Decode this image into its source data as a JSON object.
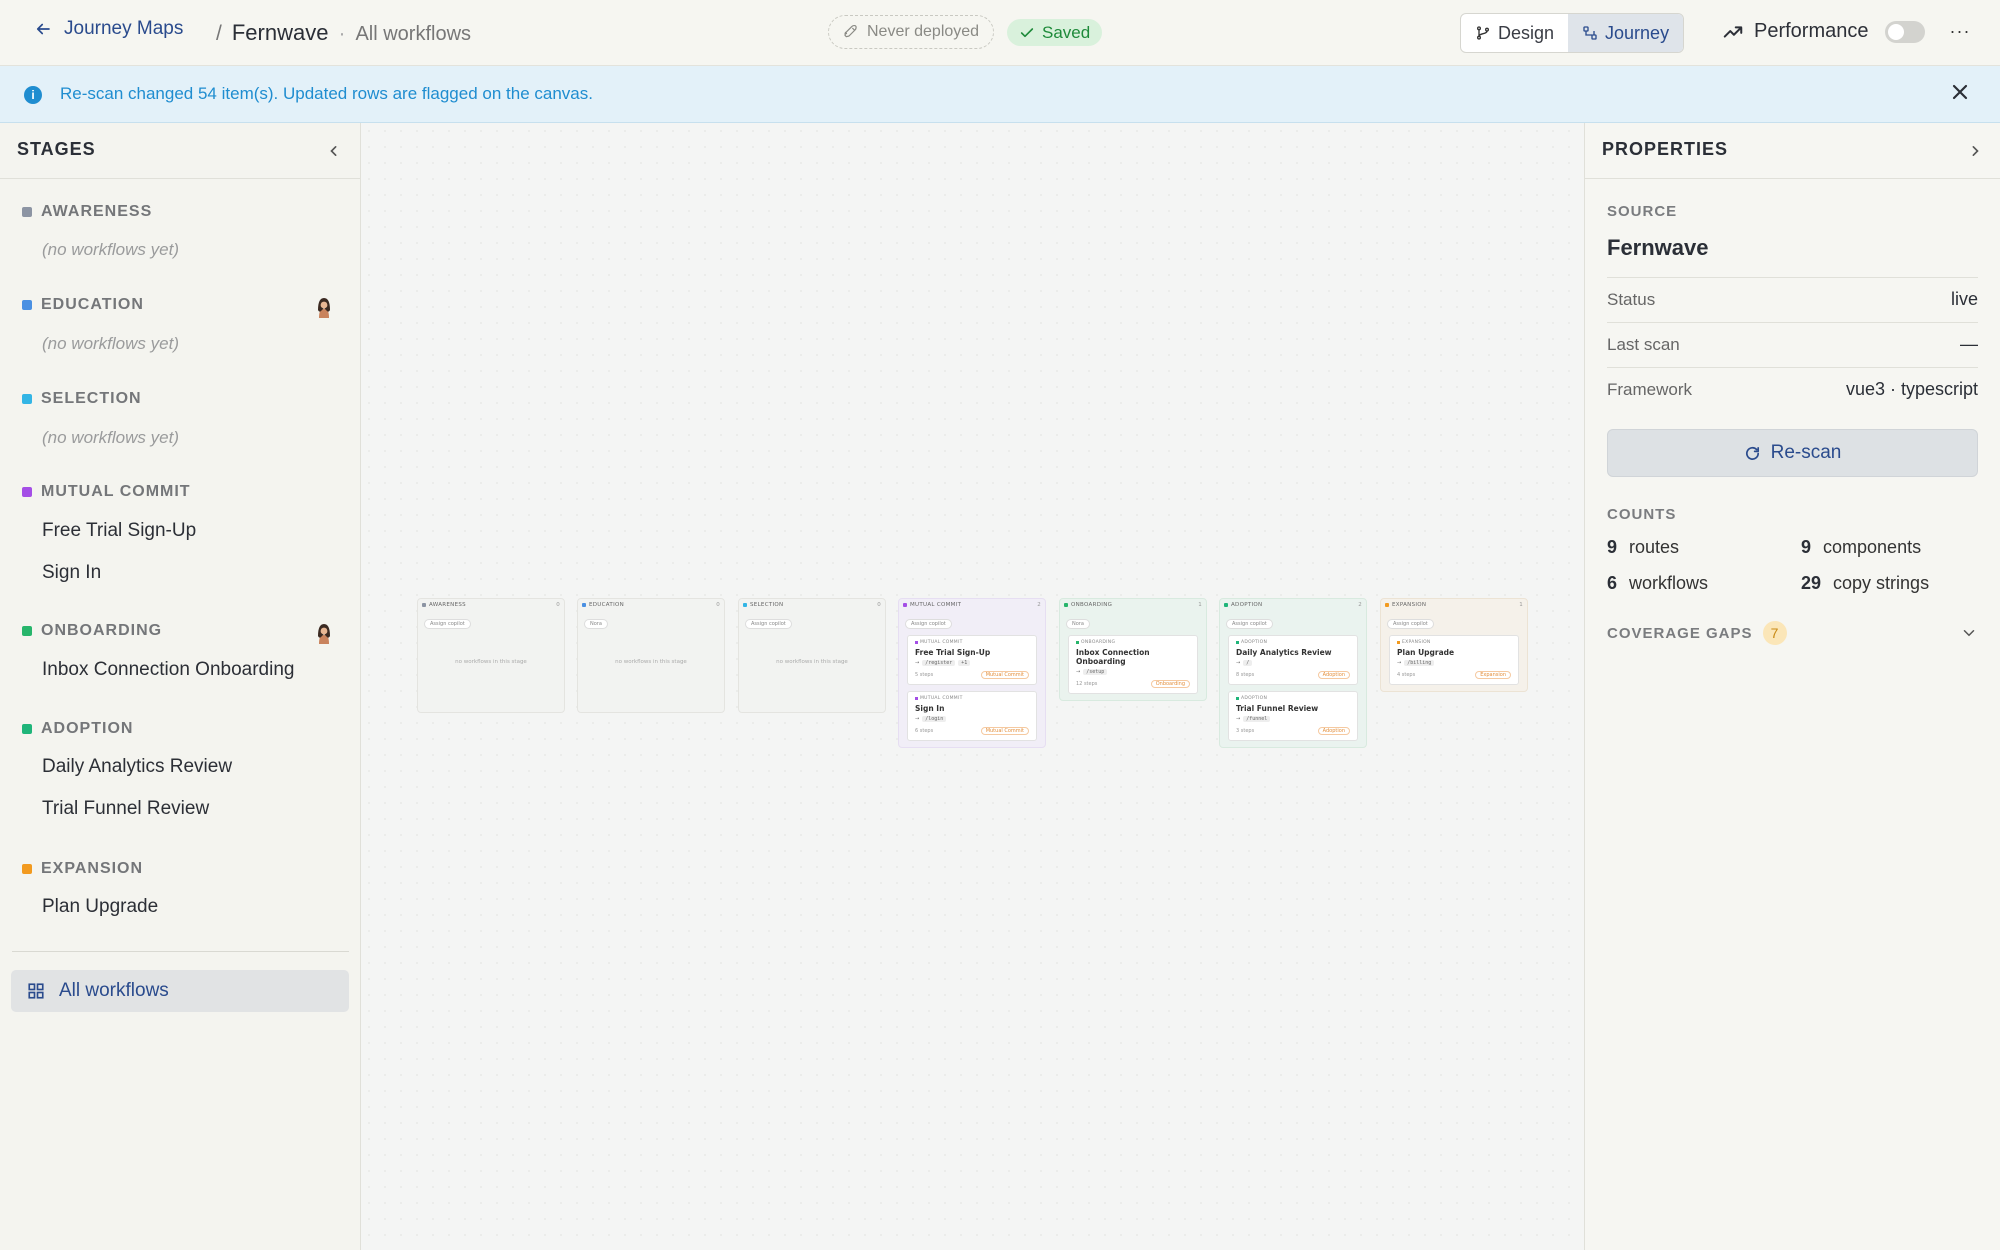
{
  "topbar": {
    "back_label": "Journey Maps",
    "crumb_sep": "/",
    "crumb_current": "Fernwave",
    "crumb_dot": "·",
    "crumb_sub": "All workflows",
    "deploy_status": "Never deployed",
    "save_status": "Saved",
    "views": [
      "Design",
      "Journey"
    ],
    "active_view": "Journey",
    "performance_label": "Performance",
    "more": "···"
  },
  "banner": {
    "message": "Re-scan changed 54 item(s). Updated rows are flagged on the canvas."
  },
  "left": {
    "title": "STAGES",
    "stages": [
      {
        "name": "AWARENESS",
        "color": "#8c94a3",
        "empty": "(no workflows yet)"
      },
      {
        "name": "EDUCATION",
        "color": "#4a90e2",
        "empty": "(no workflows yet)"
      },
      {
        "name": "SELECTION",
        "color": "#33b5e5",
        "empty": "(no workflows yet)"
      },
      {
        "name": "MUTUAL COMMIT",
        "color": "#a44ee6",
        "workflows": [
          "Free Trial Sign-Up",
          "Sign In"
        ]
      },
      {
        "name": "ONBOARDING",
        "color": "#27b56b",
        "workflows": [
          "Inbox Connection Onboarding"
        ]
      },
      {
        "name": "ADOPTION",
        "color": "#1fb57a",
        "workflows": [
          "Daily Analytics Review",
          "Trial Funnel Review"
        ]
      },
      {
        "name": "EXPANSION",
        "color": "#f29a1f",
        "workflows": [
          "Plan Upgrade"
        ]
      }
    ],
    "all_workflows": "All workflows"
  },
  "canvas": {
    "columns": [
      {
        "name": "AWARENESS",
        "count": "0",
        "assign": "Assign copilot",
        "empty": "no workflows in this stage"
      },
      {
        "name": "EDUCATION",
        "count": "0",
        "assign": "Nora",
        "empty": "no workflows in this stage"
      },
      {
        "name": "SELECTION",
        "count": "0",
        "assign": "Assign copilot",
        "empty": "no workflows in this stage"
      },
      {
        "name": "MUTUAL COMMIT",
        "count": "2",
        "assign": "Assign copilot"
      },
      {
        "name": "ONBOARDING",
        "count": "1",
        "assign": "Nora"
      },
      {
        "name": "ADOPTION",
        "count": "2",
        "assign": "Assign copilot"
      },
      {
        "name": "EXPANSION",
        "count": "1",
        "assign": "Assign copilot"
      }
    ],
    "cards": [
      {
        "stage": "MUTUAL COMMIT",
        "title": "Free Trial Sign-Up",
        "route": "/register",
        "extra": "+1",
        "steps": "5 steps",
        "tag": "Mutual Commit"
      },
      {
        "stage": "MUTUAL COMMIT",
        "title": "Sign In",
        "route": "/login",
        "steps": "6 steps",
        "tag": "Mutual Commit"
      },
      {
        "stage": "ONBOARDING",
        "title": "Inbox Connection Onboarding",
        "route": "/setup",
        "steps": "12 steps",
        "tag": "Onboarding"
      },
      {
        "stage": "ADOPTION",
        "title": "Daily Analytics Review",
        "route": "/",
        "steps": "8 steps",
        "tag": "Adoption"
      },
      {
        "stage": "ADOPTION",
        "title": "Trial Funnel Review",
        "route": "/funnel",
        "steps": "3 steps",
        "tag": "Adoption"
      },
      {
        "stage": "EXPANSION",
        "title": "Plan Upgrade",
        "route": "/billing",
        "steps": "4 steps",
        "tag": "Expansion"
      }
    ]
  },
  "right": {
    "title": "PROPERTIES",
    "source_label": "SOURCE",
    "source_name": "Fernwave",
    "rows": [
      {
        "k": "Status",
        "v": "live"
      },
      {
        "k": "Last scan",
        "v": "—"
      },
      {
        "k": "Framework",
        "v": "vue3 · typescript"
      }
    ],
    "rescan": "Re-scan",
    "counts_label": "COUNTS",
    "counts": [
      {
        "n": "9",
        "label": "routes"
      },
      {
        "n": "9",
        "label": "components"
      },
      {
        "n": "6",
        "label": "workflows"
      },
      {
        "n": "29",
        "label": "copy strings"
      }
    ],
    "gaps_label": "COVERAGE GAPS",
    "gaps_count": "7"
  }
}
